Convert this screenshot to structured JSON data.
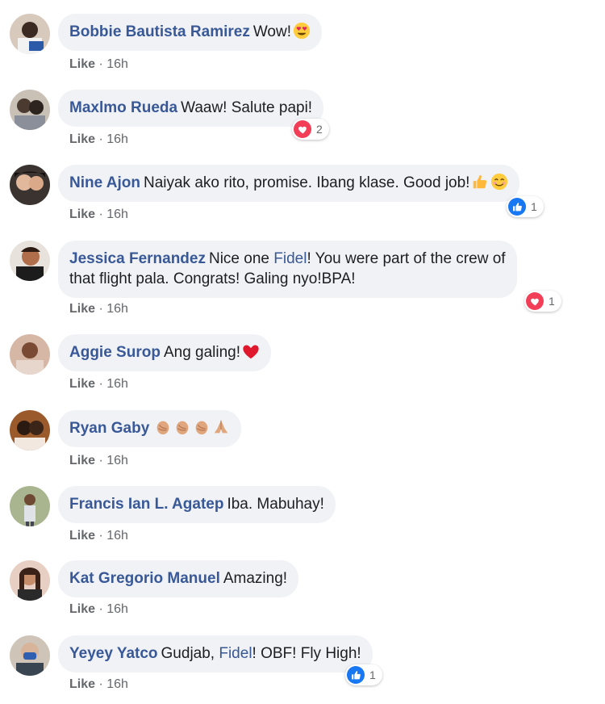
{
  "comments": [
    {
      "name": "Bobbie Bautista Ramirez",
      "text": "Wow!",
      "like": "Like",
      "time": "16h"
    },
    {
      "name": "Maxlmo Rueda",
      "text": "Waaw! Salute papi!",
      "like": "Like",
      "time": "16h",
      "reaction_count": "2",
      "reaction_type": "love"
    },
    {
      "name": "Nine Ajon",
      "text": "Naiyak ako rito, promise. Ibang klase. Good job!",
      "like": "Like",
      "time": "16h",
      "reaction_count": "1",
      "reaction_type": "like"
    },
    {
      "name": "Jessica Fernandez",
      "text_before": "Nice one ",
      "mention": "Fidel",
      "text_after_line1": "! You were part of the crew of",
      "text_line2": "that flight pala. Congrats! Galing nyo!BPA!",
      "like": "Like",
      "time": "16h",
      "reaction_count": "1",
      "reaction_type": "love"
    },
    {
      "name": "Aggie Surop",
      "text": "Ang galing!",
      "like": "Like",
      "time": "16h"
    },
    {
      "name": "Ryan Gaby",
      "text": "",
      "like": "Like",
      "time": "16h"
    },
    {
      "name": "Francis Ian L. Agatep",
      "text": "Iba. Mabuhay!",
      "like": "Like",
      "time": "16h"
    },
    {
      "name": "Kat Gregorio Manuel",
      "text": "Amazing!",
      "like": "Like",
      "time": "16h"
    },
    {
      "name": "Yeyey Yatco",
      "text_before": "Gudjab, ",
      "mention": "Fidel",
      "text_after": "! OBF! Fly High!",
      "like": "Like",
      "time": "16h",
      "reaction_count": "1",
      "reaction_type": "like"
    }
  ],
  "separator": " · ",
  "colors": {
    "name": "#385898",
    "bubble": "#f0f2f5",
    "meta": "#65676b",
    "love": "#f33e58",
    "like": "#1877f2"
  }
}
